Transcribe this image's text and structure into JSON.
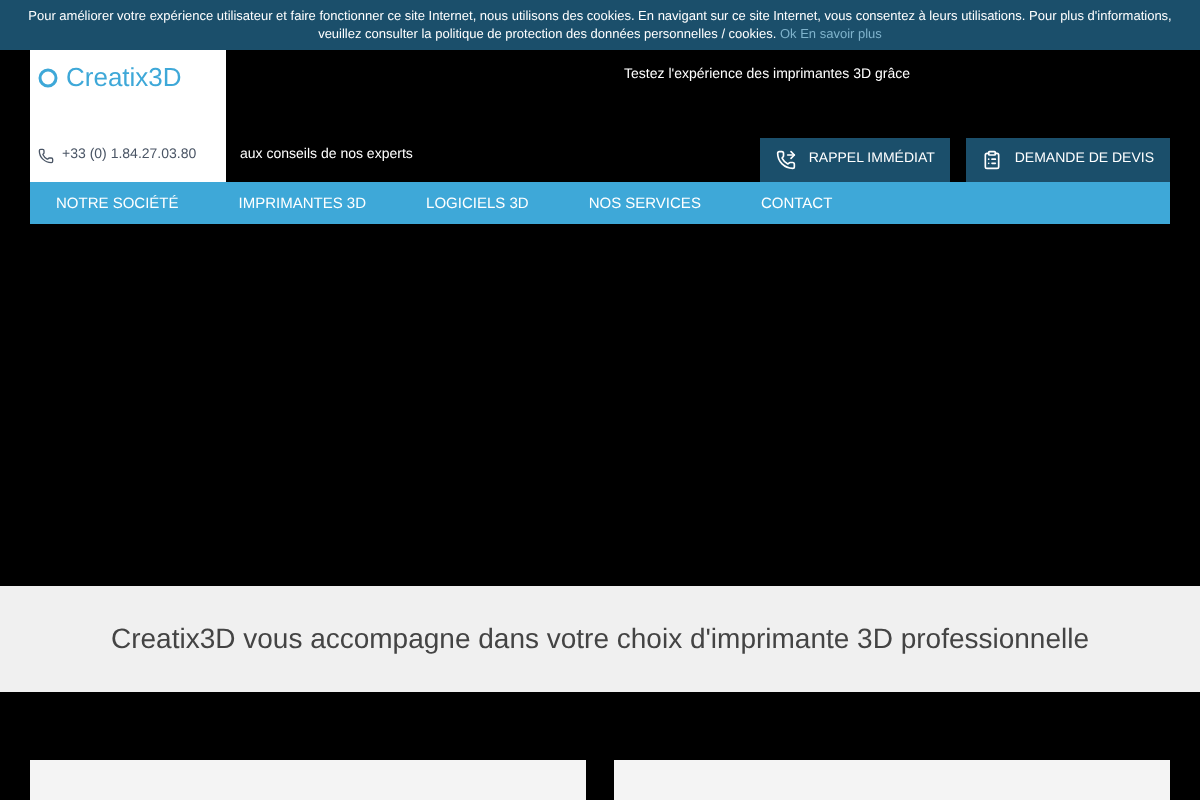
{
  "cookie_banner": {
    "text": "Pour améliorer votre expérience utilisateur et faire fonctionner ce site Internet, nous utilisons des cookies. En navigant sur ce site Internet, vous consentez à leurs utilisations. Pour plus d'informations, veuillez consulter la politique de protection des données personnelles / cookies.",
    "ok": "Ok",
    "more": "En savoir plus"
  },
  "header": {
    "logo": "Creatix3D",
    "phone": "+33 (0) 1.84.27.03.80",
    "tagline_1": "Testez l'expérience des imprimantes 3D grâce",
    "tagline_2": "aux conseils de nos experts",
    "actions": [
      {
        "kind": "phone",
        "label": "RAPPEL IMMÉDIAT"
      },
      {
        "kind": "quote",
        "label": "DEMANDE DE DEVIS"
      }
    ]
  },
  "nav": [
    {
      "label": "NOTRE SOCIÉTÉ",
      "selected": false
    },
    {
      "label": "IMPRIMANTES 3D",
      "selected": false
    },
    {
      "label": "LOGICIELS 3D",
      "selected": false
    },
    {
      "label": "NOS SERVICES",
      "selected": false
    },
    {
      "label": "CONTACT",
      "selected": false
    }
  ],
  "intro": {
    "heading": "Creatix3D vous accompagne dans votre choix d'imprimante 3D professionnelle"
  }
}
